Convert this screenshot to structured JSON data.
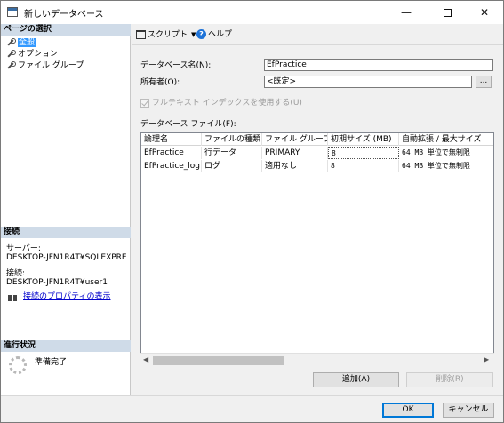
{
  "window": {
    "title": "新しいデータベース",
    "minimize": "—",
    "close": "✕"
  },
  "left_pane": {
    "page_select_header": "ページの選択",
    "pages": [
      {
        "label": "全般",
        "selected": true
      },
      {
        "label": "オプション",
        "selected": false
      },
      {
        "label": "ファイル グループ",
        "selected": false
      }
    ],
    "connection_header": "接続",
    "server_label": "サーバー:",
    "server_value": "DESKTOP-JFN1R4T¥SQLEXPRE",
    "connection_label": "接続:",
    "connection_value": "DESKTOP-JFN1R4T¥user1",
    "connection_properties_link": "接続のプロパティの表示",
    "progress_header": "進行状況",
    "progress_status": "準備完了"
  },
  "toolbar": {
    "script_label": "スクリプト",
    "help_label": "ヘルプ"
  },
  "form": {
    "db_name_label": "データベース名(N):",
    "db_name_value": "EfPractice",
    "owner_label": "所有者(O):",
    "owner_value": "<既定>",
    "owner_browse": "...",
    "fulltext_label": "フルテキスト インデックスを使用する(U)",
    "files_label": "データベース ファイル(F):"
  },
  "files_grid": {
    "columns": [
      "論理名",
      "ファイルの種類",
      "ファイル グループ",
      "初期サイズ (MB)",
      "自動拡張 / 最大サイズ"
    ],
    "rows": [
      [
        "EfPractice",
        "行データ",
        "PRIMARY",
        "8",
        "64 MB 単位で無制限"
      ],
      [
        "EfPractice_log",
        "ログ",
        "適用なし",
        "8",
        "64 MB 単位で無制限"
      ]
    ]
  },
  "buttons": {
    "add": "追加(A)",
    "remove": "削除(R)",
    "ok": "OK",
    "cancel": "キャンセル"
  },
  "icons": {
    "page_item": "wrench-icon",
    "script": "script-icon",
    "help": "help-icon",
    "connection_properties": "connection-icon",
    "progress": "spinner-icon"
  }
}
